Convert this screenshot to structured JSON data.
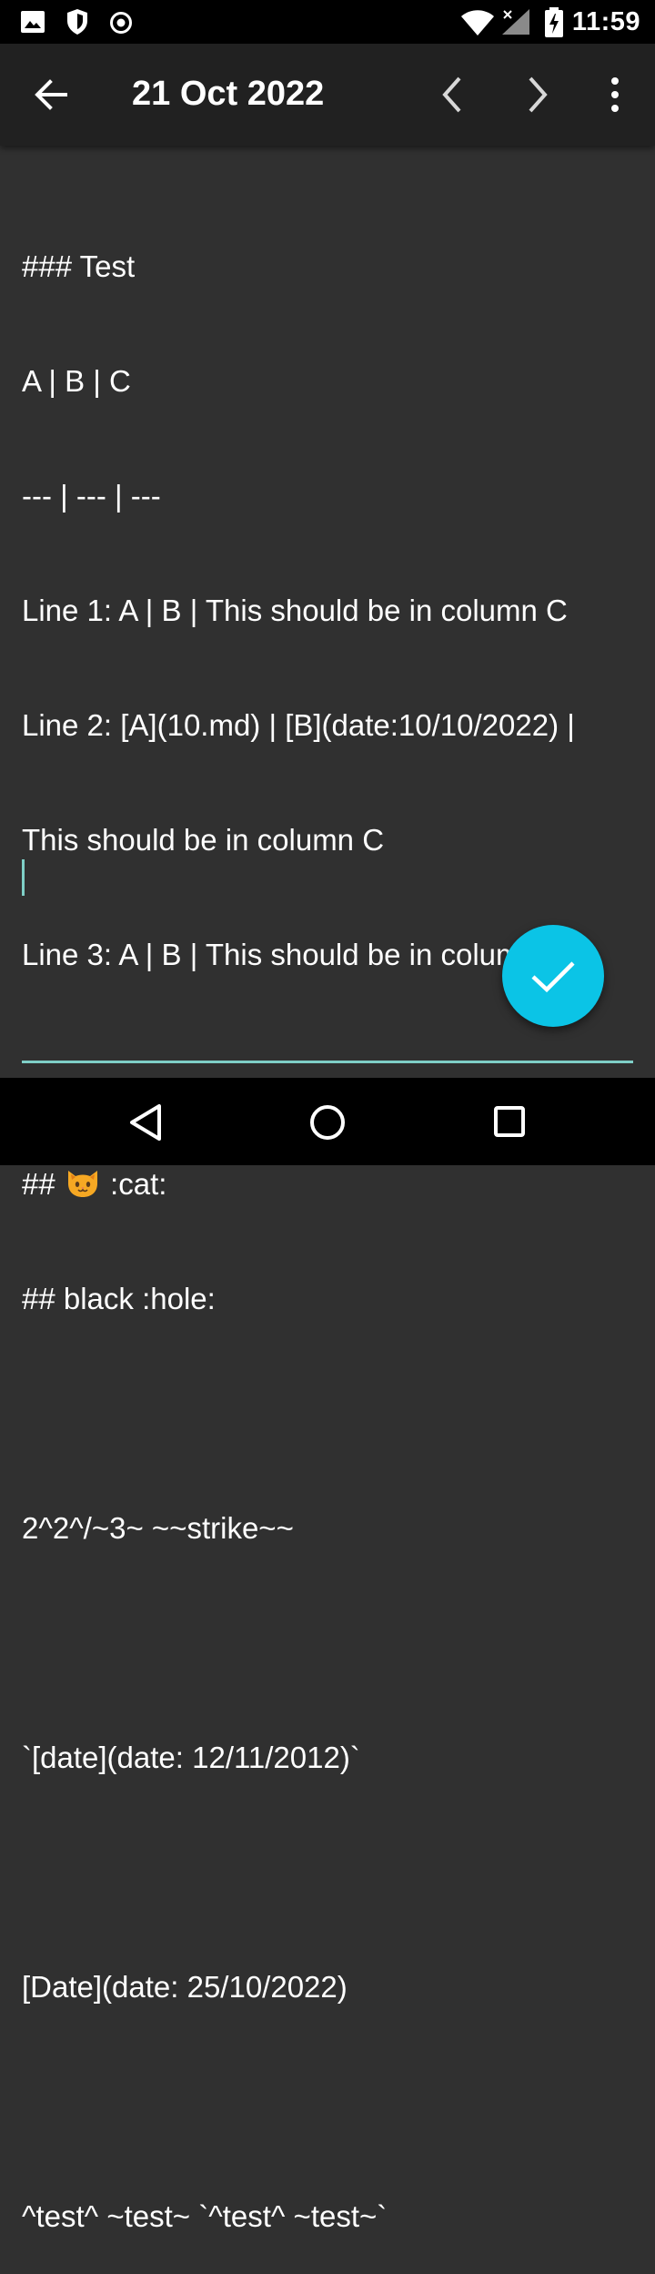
{
  "status_bar": {
    "time": "11:59",
    "icons": [
      "image-icon",
      "shield-icon",
      "record-icon",
      "wifi-icon",
      "signal-icon",
      "battery-charging-icon"
    ]
  },
  "app_bar": {
    "title": "21 Oct 2022",
    "back_icon": "arrow-back-icon",
    "prev_icon": "chevron-left-icon",
    "next_icon": "chevron-right-icon",
    "menu_icon": "more-vert-icon"
  },
  "editor": {
    "lines": [
      "### Test",
      "A   | B   | C",
      "--- | --- | ---",
      "Line 1: A | B | This should be in column C",
      "Line 2: [A](10.md) | [B](date:10/10/2022) |",
      "This should be in column C",
      "Line 3: A | B | This should be in column C",
      "",
      "##   ",
      ":cat:",
      "## black :hole:",
      "",
      "2^2^/~3~ ~~strike~~",
      "",
      "`[date](date: 12/11/2012)`",
      "",
      "[Date](date: 25/10/2022)",
      "",
      "^test^ ~test~ `^test^ ~test~`"
    ]
  },
  "fab": {
    "icon": "check-icon",
    "color": "#0bc4e6"
  },
  "nav_bar": {
    "icons": [
      "back-triangle-icon",
      "home-circle-icon",
      "recents-square-icon"
    ]
  },
  "colors": {
    "background": "#303030",
    "app_bar": "#212121",
    "accent": "#7fcfc7"
  }
}
